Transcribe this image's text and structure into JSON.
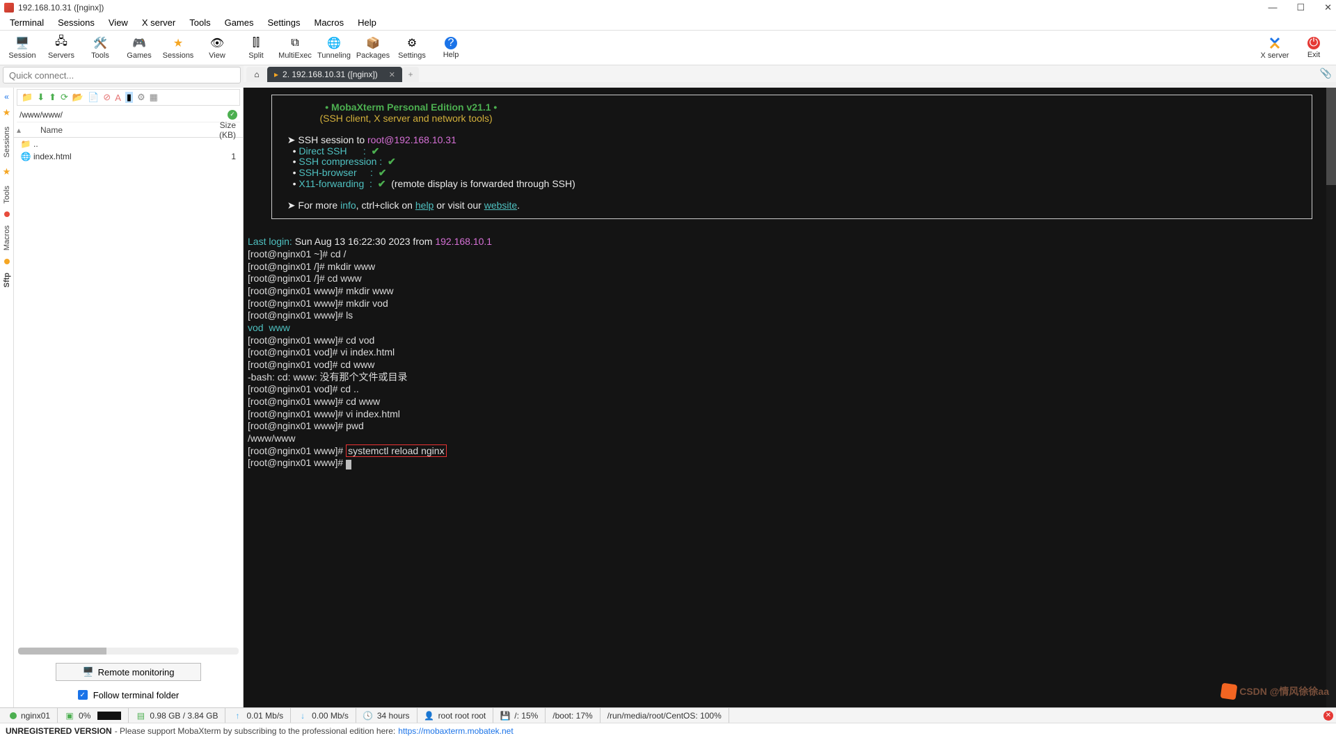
{
  "window": {
    "title": "192.168.10.31 ([nginx])"
  },
  "menu": {
    "items": [
      "Terminal",
      "Sessions",
      "View",
      "X server",
      "Tools",
      "Games",
      "Settings",
      "Macros",
      "Help"
    ]
  },
  "toolbar_left": [
    {
      "icon": "🖥️",
      "label": "Session"
    },
    {
      "icon": "🖧",
      "label": "Servers"
    },
    {
      "icon": "🛠️",
      "label": "Tools"
    },
    {
      "icon": "🎮",
      "label": "Games"
    },
    {
      "icon": "★",
      "label": "Sessions"
    },
    {
      "icon": "👁",
      "label": "View"
    },
    {
      "icon": "⫿⫿",
      "label": "Split"
    },
    {
      "icon": "⧉",
      "label": "MultiExec"
    },
    {
      "icon": "🌐",
      "label": "Tunneling"
    },
    {
      "icon": "📦",
      "label": "Packages"
    },
    {
      "icon": "⚙",
      "label": "Settings"
    },
    {
      "icon": "?",
      "label": "Help"
    }
  ],
  "toolbar_right": [
    {
      "icon": "X",
      "label": "X server",
      "color": "#1a73e8"
    },
    {
      "icon": "⏻",
      "label": "Exit",
      "color": "#e53935"
    }
  ],
  "quick_connect": {
    "placeholder": "Quick connect..."
  },
  "side_tabs": [
    "Sessions",
    "Tools",
    "Macros",
    "Sftp"
  ],
  "sftp": {
    "path": "/www/www/",
    "cols": {
      "name": "Name",
      "size": "Size (KB)"
    },
    "files": [
      {
        "icon": "folder-up",
        "name": "..",
        "size": ""
      },
      {
        "icon": "html",
        "name": "index.html",
        "size": "1"
      }
    ]
  },
  "remote_monitoring": "Remote monitoring",
  "follow_terminal": "Follow terminal folder",
  "tabs": {
    "active_label": "2. 192.168.10.31 ([nginx])"
  },
  "term_box": {
    "title_left": "• MobaXterm Personal Edition v21.1 •",
    "subtitle": "(SSH client, X server and network tools)",
    "ssh_to_pre": "SSH session to ",
    "ssh_to_host": "root@192.168.10.31",
    "l1": "Direct SSH      :  ",
    "l2": "SSH compression :  ",
    "l3": "SSH-browser     :  ",
    "l4": "X11-forwarding  :  ",
    "l4_tail": "  (remote display is forwarded through SSH)",
    "more_pre": "For more ",
    "info": "info",
    "more_mid": ", ctrl+click on ",
    "help": "help",
    "more_mid2": " or visit our ",
    "website": "website",
    "dot": "."
  },
  "term_lines": {
    "lastlogin_pre": "Last login:",
    "lastlogin_mid": " Sun Aug 13 16:22:30 2023 from ",
    "lastlogin_ip": "192.168.10.1",
    "p_home": "[root@nginx01 ~]# ",
    "p_root": "[root@nginx01 /]# ",
    "p_www": "[root@nginx01 www]# ",
    "p_vod": "[root@nginx01 vod]# ",
    "c1": "cd /",
    "c2": "mkdir www",
    "c3": "cd www",
    "c4": "mkdir www",
    "c5": "mkdir vod",
    "c6": "ls",
    "ls_out": "vod  www",
    "c7": "cd vod",
    "c8": "vi index.html",
    "c9": "cd www",
    "bash_err": "-bash: cd: www: 没有那个文件或目录",
    "c10": "cd ..",
    "c11": "cd www",
    "c12": "vi index.html",
    "c13": "pwd",
    "pwd_out": "/www/www",
    "c14": "systemctl reload nginx"
  },
  "status": {
    "host": "nginx01",
    "cpu": "0%",
    "mem": "0.98 GB / 3.84 GB",
    "up": "0.01 Mb/s",
    "down": "0.00 Mb/s",
    "uptime": "34 hours",
    "user": "root  root  root",
    "disk": "/: 15%",
    "boot": "/boot: 17%",
    "media": "/run/media/root/CentOS: 100%"
  },
  "footer": {
    "unreg": "UNREGISTERED VERSION",
    "support": "-   Please support MobaXterm by subscribing to the professional edition here:",
    "url": "https://mobaxterm.mobatek.net"
  },
  "watermark": "CSDN @情风徐徐aa"
}
